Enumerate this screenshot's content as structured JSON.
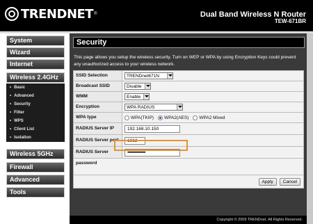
{
  "brand": {
    "name": "TRENDNET",
    "reg": "®"
  },
  "product": {
    "name": "Dual Band Wireless N Router",
    "model": "TEW-671BR"
  },
  "sidebar": {
    "main_items": [
      {
        "label": "System"
      },
      {
        "label": "Wizard"
      },
      {
        "label": "Internet"
      },
      {
        "label": "Wireless 2.4GHz"
      },
      {
        "label": "Wireless 5GHz"
      },
      {
        "label": "Firewall"
      },
      {
        "label": "Advanced"
      },
      {
        "label": "Tools"
      }
    ],
    "sub_items": [
      {
        "label": "Basic"
      },
      {
        "label": "Advanced"
      },
      {
        "label": "Security"
      },
      {
        "label": "Filter"
      },
      {
        "label": "WPS"
      },
      {
        "label": "Client List"
      },
      {
        "label": "Isolation"
      }
    ]
  },
  "page": {
    "title": "Security",
    "description": "This page allows you setup the wireless security. Turn on WEP or WPA by using Encryption Keys could prevent any unauthorized access to your wireless network."
  },
  "form": {
    "ssid_selection": {
      "label": "SSID Selection",
      "value": "TRENDnet671N"
    },
    "broadcast_ssid": {
      "label": "Broadcast SSID",
      "value": "Disable"
    },
    "wmm": {
      "label": "WMM",
      "value": "Enable"
    },
    "encryption": {
      "label": "Encryption",
      "value": "WPA RADIUS"
    },
    "wpa_type": {
      "label": "WPA type",
      "options": [
        "WPA(TKIP)",
        "WPA2(AES)",
        "WPA2 Mixed"
      ],
      "selected": "WPA2(AES)"
    },
    "radius_ip": {
      "label": "RADIUS Server IP address",
      "value": "192.168.10.150"
    },
    "radius_port": {
      "label": "RADIUS Server port",
      "value": "1812"
    },
    "radius_password": {
      "label": "RADIUS Server password",
      "value": "••••••••••••••••••••"
    }
  },
  "buttons": {
    "apply": "Apply",
    "cancel": "Cancel"
  },
  "footer": {
    "copyright": "Copyright © 2009 TRENDnet. All Rights Reserved."
  },
  "colors": {
    "highlight": "#e8922b",
    "nav_bg": "#2d2d2d",
    "header_bg": "#000000"
  }
}
